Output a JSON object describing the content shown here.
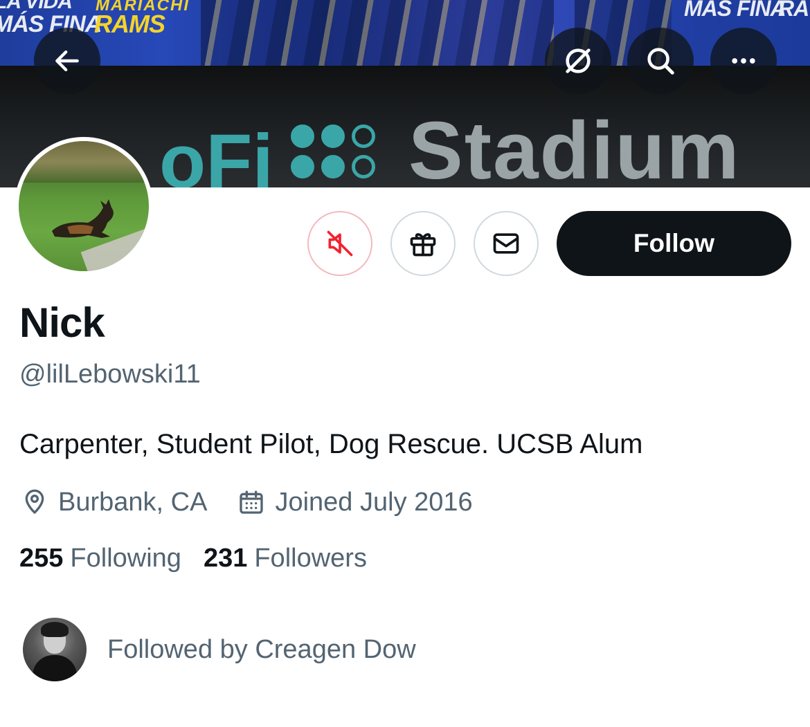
{
  "banner": {
    "words": [
      "LA VIDA",
      "MÁS FINA",
      "MARIACHI",
      "RAMS",
      "MÁS FINA",
      "RA"
    ],
    "sign_left": "oFi",
    "sign_right": "Stadium"
  },
  "top_actions": {
    "back_icon": "arrow-left-icon",
    "hide_icon": "no-entry-icon",
    "search_icon": "search-icon",
    "more_icon": "more-horizontal-icon"
  },
  "actions": {
    "mute_icon": "mute-icon",
    "mute_color": "#f4212e",
    "gift_icon": "gift-icon",
    "message_icon": "mail-icon",
    "follow_label": "Follow"
  },
  "profile": {
    "name": "Nick",
    "handle": "@lilLebowski11",
    "bio": "Carpenter, Student Pilot, Dog Rescue. UCSB Alum",
    "location": "Burbank, CA",
    "joined": "Joined July 2016",
    "following_count": "255",
    "following_label": "Following",
    "followers_count": "231",
    "followers_label": "Followers",
    "followed_by": "Followed by Creagen Dow"
  },
  "colors": {
    "text_primary": "#0f1419",
    "text_secondary": "#536471",
    "border": "#cfd9de"
  }
}
